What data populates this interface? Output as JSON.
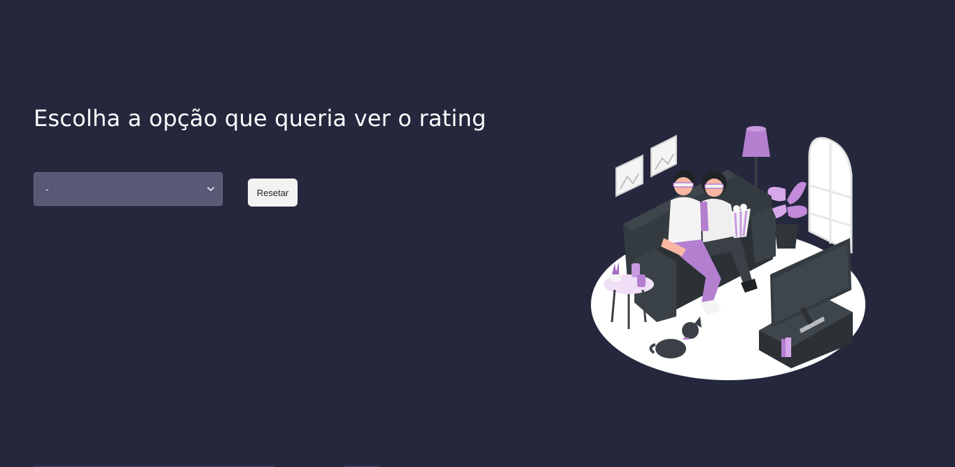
{
  "page": {
    "title": "Escolha a opção que queria ver o rating"
  },
  "controls": {
    "select": {
      "value": "-"
    },
    "reset_label": "Resetar"
  },
  "colors": {
    "background": "#25273d",
    "select_bg": "#595976",
    "button_bg": "#f2f2f2",
    "accent_purple": "#b57fd0"
  },
  "illustration": {
    "name": "couple-watching-tv-illustration"
  }
}
